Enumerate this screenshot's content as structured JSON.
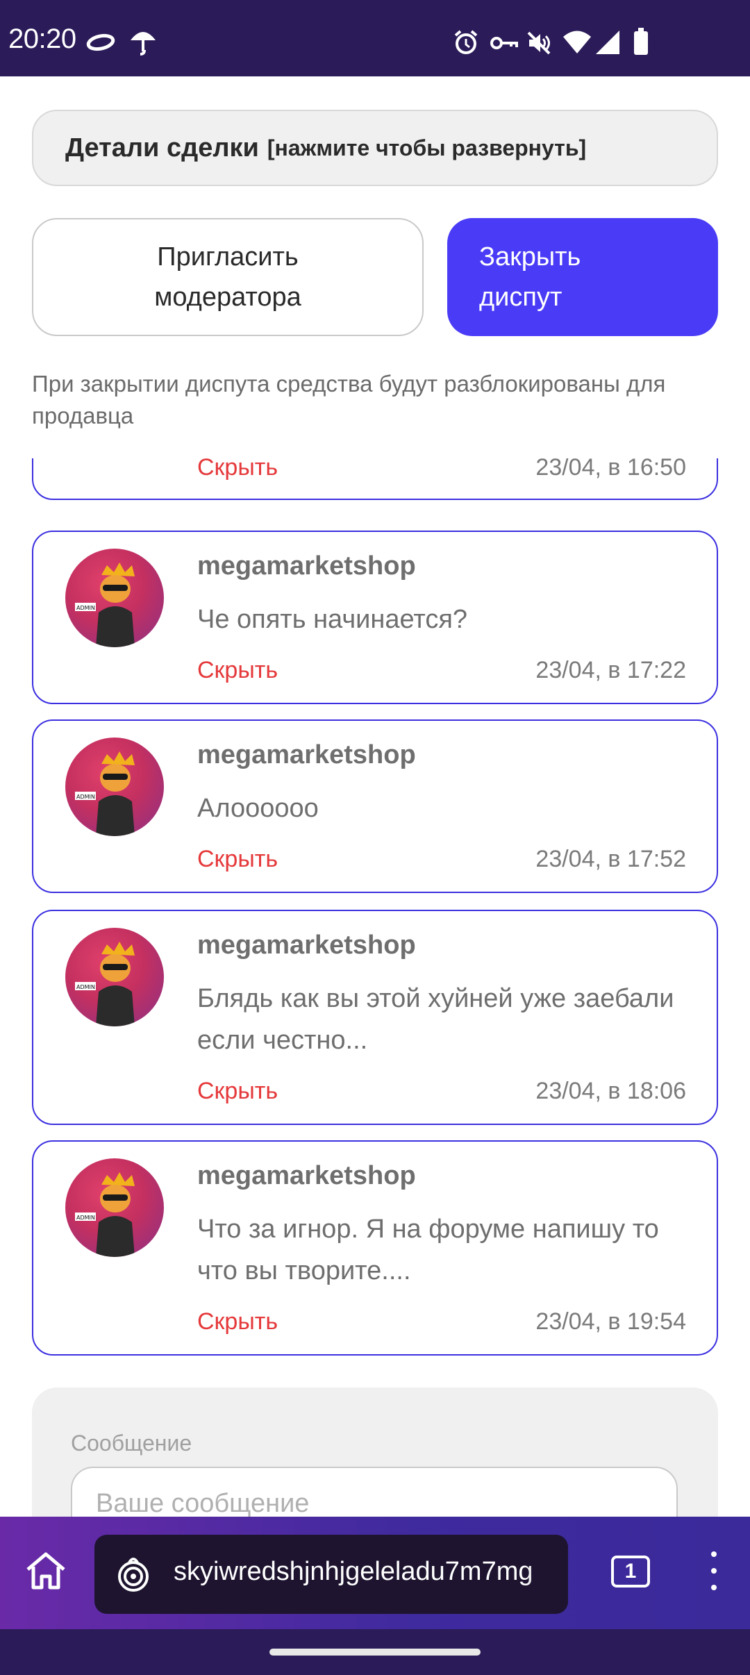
{
  "status_bar": {
    "time": "20:20",
    "icons": [
      "halo-icon",
      "umbrella-icon",
      "alarm-icon",
      "key-icon",
      "mute-icon",
      "wifi-icon",
      "signal-icon",
      "battery-icon"
    ]
  },
  "deal_details": {
    "title": "Детали сделки",
    "hint": "[нажмите чтобы развернуть]"
  },
  "actions": {
    "invite_moderator": "Пригласить модератора",
    "close_dispute": "Закрыть диспут"
  },
  "close_note": "При закрытии диспута средства будут разблокированы для продавца",
  "messages": [
    {
      "user": "",
      "text": "",
      "hide_label": "Скрыть",
      "time": "23/04, в 16:50"
    },
    {
      "user": "megamarketshop",
      "text": "Че опять начинается?",
      "hide_label": "Скрыть",
      "time": "23/04, в 17:22"
    },
    {
      "user": "megamarketshop",
      "text": "Алоооооо",
      "hide_label": "Скрыть",
      "time": "23/04, в 17:52"
    },
    {
      "user": "megamarketshop",
      "text": "Блядь как вы этой хуйней уже заебали если честно...",
      "hide_label": "Скрыть",
      "time": "23/04, в 18:06"
    },
    {
      "user": "megamarketshop",
      "text": "Что за игнор. Я на форуме напишу то что вы творите....",
      "hide_label": "Скрыть",
      "time": "23/04, в 19:54"
    }
  ],
  "compose": {
    "label": "Сообщение",
    "placeholder": "Ваше сообщение"
  },
  "browser": {
    "url": "skyiwredshjnhjgeleladu7m7mg",
    "tab_count": "1"
  },
  "colors": {
    "accent": "#4a3cf6",
    "card_border": "#3b2fe0",
    "hide_red": "#e5393b",
    "status_bar": "#2b1b58"
  }
}
